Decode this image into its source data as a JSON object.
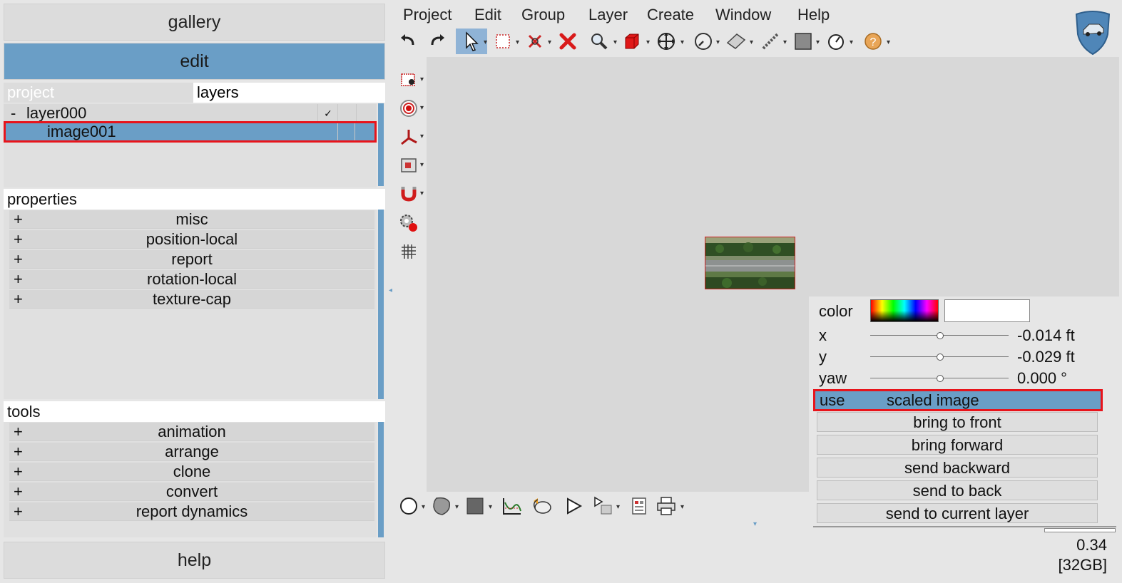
{
  "left": {
    "gallery": "gallery",
    "edit": "edit",
    "tabs": {
      "project": "project",
      "layers": "layers"
    },
    "tree": {
      "layer": {
        "toggle": "-",
        "name": "layer000",
        "check": "✓"
      },
      "image": {
        "name": "image001"
      }
    },
    "properties": {
      "title": "properties",
      "items": [
        {
          "plus": "+",
          "label": "misc"
        },
        {
          "plus": "+",
          "label": "position-local"
        },
        {
          "plus": "+",
          "label": "report"
        },
        {
          "plus": "+",
          "label": "rotation-local"
        },
        {
          "plus": "+",
          "label": "texture-cap"
        }
      ]
    },
    "tools": {
      "title": "tools",
      "items": [
        {
          "plus": "+",
          "label": "animation"
        },
        {
          "plus": "+",
          "label": "arrange"
        },
        {
          "plus": "+",
          "label": "clone"
        },
        {
          "plus": "+",
          "label": "convert"
        },
        {
          "plus": "+",
          "label": "report dynamics"
        }
      ]
    },
    "help": "help"
  },
  "menu": [
    "Project",
    "Edit",
    "Group",
    "Layer",
    "Create",
    "Window",
    "Help"
  ],
  "props": {
    "color_label": "color",
    "x": {
      "label": "x",
      "value": "-0.014 ft"
    },
    "y": {
      "label": "y",
      "value": "-0.029 ft"
    },
    "yaw": {
      "label": "yaw",
      "value": "0.000 °"
    },
    "use": {
      "label": "use",
      "value": "scaled image"
    },
    "buttons": [
      "bring to front",
      "bring forward",
      "send backward",
      "send to back",
      "send to current layer"
    ]
  },
  "status": {
    "zoom": "0.34",
    "memory": "[32GB]"
  },
  "colors": {
    "accent": "#6a9ec6",
    "highlight": "#e8141b"
  }
}
